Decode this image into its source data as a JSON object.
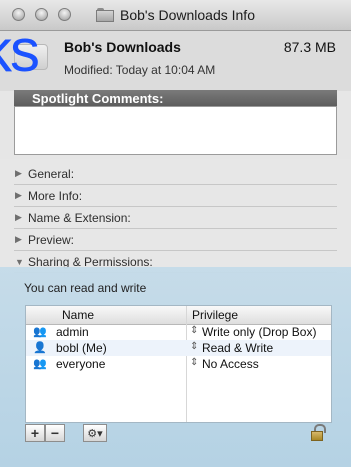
{
  "window": {
    "title": "Bob's Downloads Info"
  },
  "overlay_text": "ks",
  "header": {
    "name": "Bob's Downloads",
    "size": "87.3 MB",
    "modified": "Modified: Today at 10:04 AM"
  },
  "sections": {
    "spotlight_label": "Spotlight Comments:",
    "items": [
      "General:",
      "More Info:",
      "Name & Extension:",
      "Preview:",
      "Sharing & Permissions:"
    ]
  },
  "permissions": {
    "summary": "You can read and write",
    "columns": {
      "name": "Name",
      "privilege": "Privilege"
    },
    "rows": [
      {
        "name": "admin",
        "privilege": "Write only (Drop Box)",
        "icon": "group-users-icon"
      },
      {
        "name": "bobl (Me)",
        "privilege": "Read & Write",
        "icon": "user-icon"
      },
      {
        "name": "everyone",
        "privilege": "No Access",
        "icon": "everyone-icon"
      }
    ],
    "controls": {
      "add": "+",
      "remove": "−",
      "action": "⚙▾"
    }
  },
  "colors": {
    "accent_text": "#1b52ff",
    "panel_blue": "#c4dbe9"
  }
}
